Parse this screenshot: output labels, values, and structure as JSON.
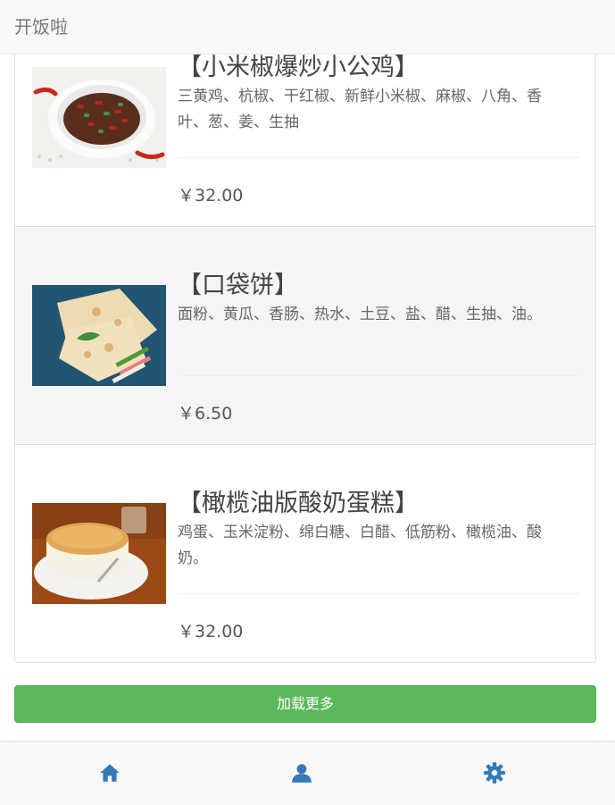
{
  "app": {
    "title": "开饭啦"
  },
  "items": [
    {
      "title": "【小米椒爆炒小公鸡】",
      "ingredients": "三黄鸡、杭椒、干红椒、新鲜小米椒、麻椒、八角、香叶、葱、姜、生抽",
      "price": "￥32.00"
    },
    {
      "title": "【口袋饼】",
      "ingredients": "面粉、黄瓜、香肠、热水、土豆、盐、醋、生抽、油。",
      "price": "￥6.50"
    },
    {
      "title": "【橄榄油版酸奶蛋糕】",
      "ingredients": "鸡蛋、玉米淀粉、绵白糖、白醋、低筋粉、橄榄油、酸奶。",
      "price": "￥32.00"
    }
  ],
  "load_more": {
    "label": "加载更多"
  },
  "tabbar": {
    "icons": [
      "home-icon",
      "user-icon",
      "gear-icon"
    ]
  },
  "colors": {
    "primary": "#337ab7",
    "success": "#5cb85c",
    "navbar": "#f8f8f8"
  }
}
